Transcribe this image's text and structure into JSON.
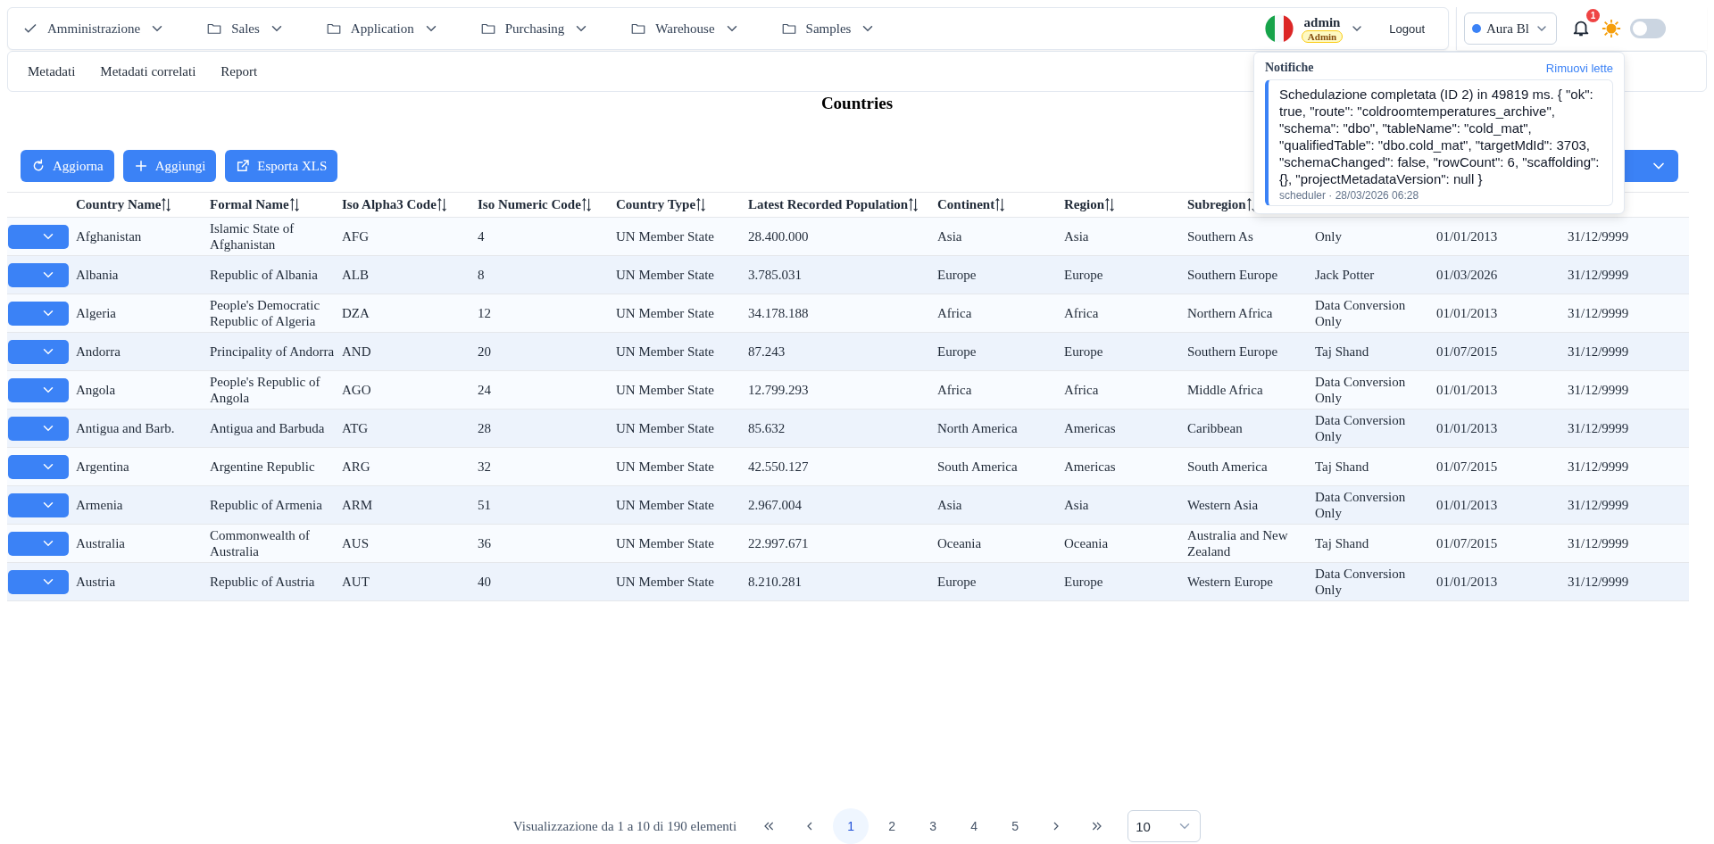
{
  "menu": [
    {
      "label": "Amministrazione"
    },
    {
      "label": "Sales"
    },
    {
      "label": "Application"
    },
    {
      "label": "Purchasing"
    },
    {
      "label": "Warehouse"
    },
    {
      "label": "Samples"
    }
  ],
  "user": {
    "name": "admin",
    "role": "Admin",
    "logout": "Logout"
  },
  "theme": {
    "label": "Aura Bl",
    "color": "#3b82f6"
  },
  "notifications": {
    "count": "1"
  },
  "dark_mode": {
    "on": false
  },
  "subnav": [
    "Metadati",
    "Metadati correlati",
    "Report"
  ],
  "page_title": "Countries",
  "actions": [
    {
      "label": "Aggiorna"
    },
    {
      "label": "Aggiungi"
    },
    {
      "label": "Esporta XLS"
    }
  ],
  "table": {
    "columns": [
      "Country Name",
      "Formal Name",
      "Iso Alpha3 Code",
      "Iso Numeric Code",
      "Country Type",
      "Latest Recorded Population",
      "Continent",
      "Region",
      "Subregion"
    ],
    "rows": [
      [
        "Afghanistan",
        "Islamic State of Afghanistan",
        "AFG",
        "4",
        "UN Member State",
        "28.400.000",
        "Asia",
        "Asia",
        "Southern As",
        "Only",
        "01/01/2013",
        "31/12/9999"
      ],
      [
        "Albania",
        "Republic of Albania",
        "ALB",
        "8",
        "UN Member State",
        "3.785.031",
        "Europe",
        "Europe",
        "Southern Europe",
        "Jack Potter",
        "01/03/2026",
        "31/12/9999"
      ],
      [
        "Algeria",
        "People's Democratic Republic of Algeria",
        "DZA",
        "12",
        "UN Member State",
        "34.178.188",
        "Africa",
        "Africa",
        "Northern Africa",
        "Data Conversion Only",
        "01/01/2013",
        "31/12/9999"
      ],
      [
        "Andorra",
        "Principality of Andorra",
        "AND",
        "20",
        "UN Member State",
        "87.243",
        "Europe",
        "Europe",
        "Southern Europe",
        "Taj Shand",
        "01/07/2015",
        "31/12/9999"
      ],
      [
        "Angola",
        "People's Republic of Angola",
        "AGO",
        "24",
        "UN Member State",
        "12.799.293",
        "Africa",
        "Africa",
        "Middle Africa",
        "Data Conversion Only",
        "01/01/2013",
        "31/12/9999"
      ],
      [
        "Antigua and Barb.",
        "Antigua and Barbuda",
        "ATG",
        "28",
        "UN Member State",
        "85.632",
        "North America",
        "Americas",
        "Caribbean",
        "Data Conversion Only",
        "01/01/2013",
        "31/12/9999"
      ],
      [
        "Argentina",
        "Argentine Republic",
        "ARG",
        "32",
        "UN Member State",
        "42.550.127",
        "South America",
        "Americas",
        "South America",
        "Taj Shand",
        "01/07/2015",
        "31/12/9999"
      ],
      [
        "Armenia",
        "Republic of Armenia",
        "ARM",
        "51",
        "UN Member State",
        "2.967.004",
        "Asia",
        "Asia",
        "Western Asia",
        "Data Conversion Only",
        "01/01/2013",
        "31/12/9999"
      ],
      [
        "Australia",
        "Commonwealth of Australia",
        "AUS",
        "36",
        "UN Member State",
        "22.997.671",
        "Oceania",
        "Oceania",
        "Australia and New Zealand",
        "Taj Shand",
        "01/07/2015",
        "31/12/9999"
      ],
      [
        "Austria",
        "Republic of Austria",
        "AUT",
        "40",
        "UN Member State",
        "8.210.281",
        "Europe",
        "Europe",
        "Western Europe",
        "Data Conversion Only",
        "01/01/2013",
        "31/12/9999"
      ]
    ]
  },
  "pagination": {
    "summary": "Visualizzazione da 1 a 10 di 190 elementi",
    "pages": [
      {
        "label": "1",
        "selected": true
      },
      {
        "label": "2",
        "selected": false
      },
      {
        "label": "3",
        "selected": false
      },
      {
        "label": "4",
        "selected": false
      },
      {
        "label": "5",
        "selected": false
      }
    ],
    "page_size": "10"
  },
  "notification_panel": {
    "title": "Notifiche",
    "action": "Rimuovi lette",
    "items": [
      {
        "message": "Schedulazione completata (ID 2) in 49819 ms. { \"ok\": true, \"route\": \"coldroomtemperatures_archive\", \"schema\": \"dbo\", \"tableName\": \"cold_mat\", \"qualifiedTable\": \"dbo.cold_mat\", \"targetMdId\": 3703, \"schemaChanged\": false, \"rowCount\": 6, \"scaffolding\": {}, \"projectMetadataVersion\": null }",
        "meta": "scheduler · 28/03/2026 06:28",
        "unread": true
      }
    ]
  }
}
